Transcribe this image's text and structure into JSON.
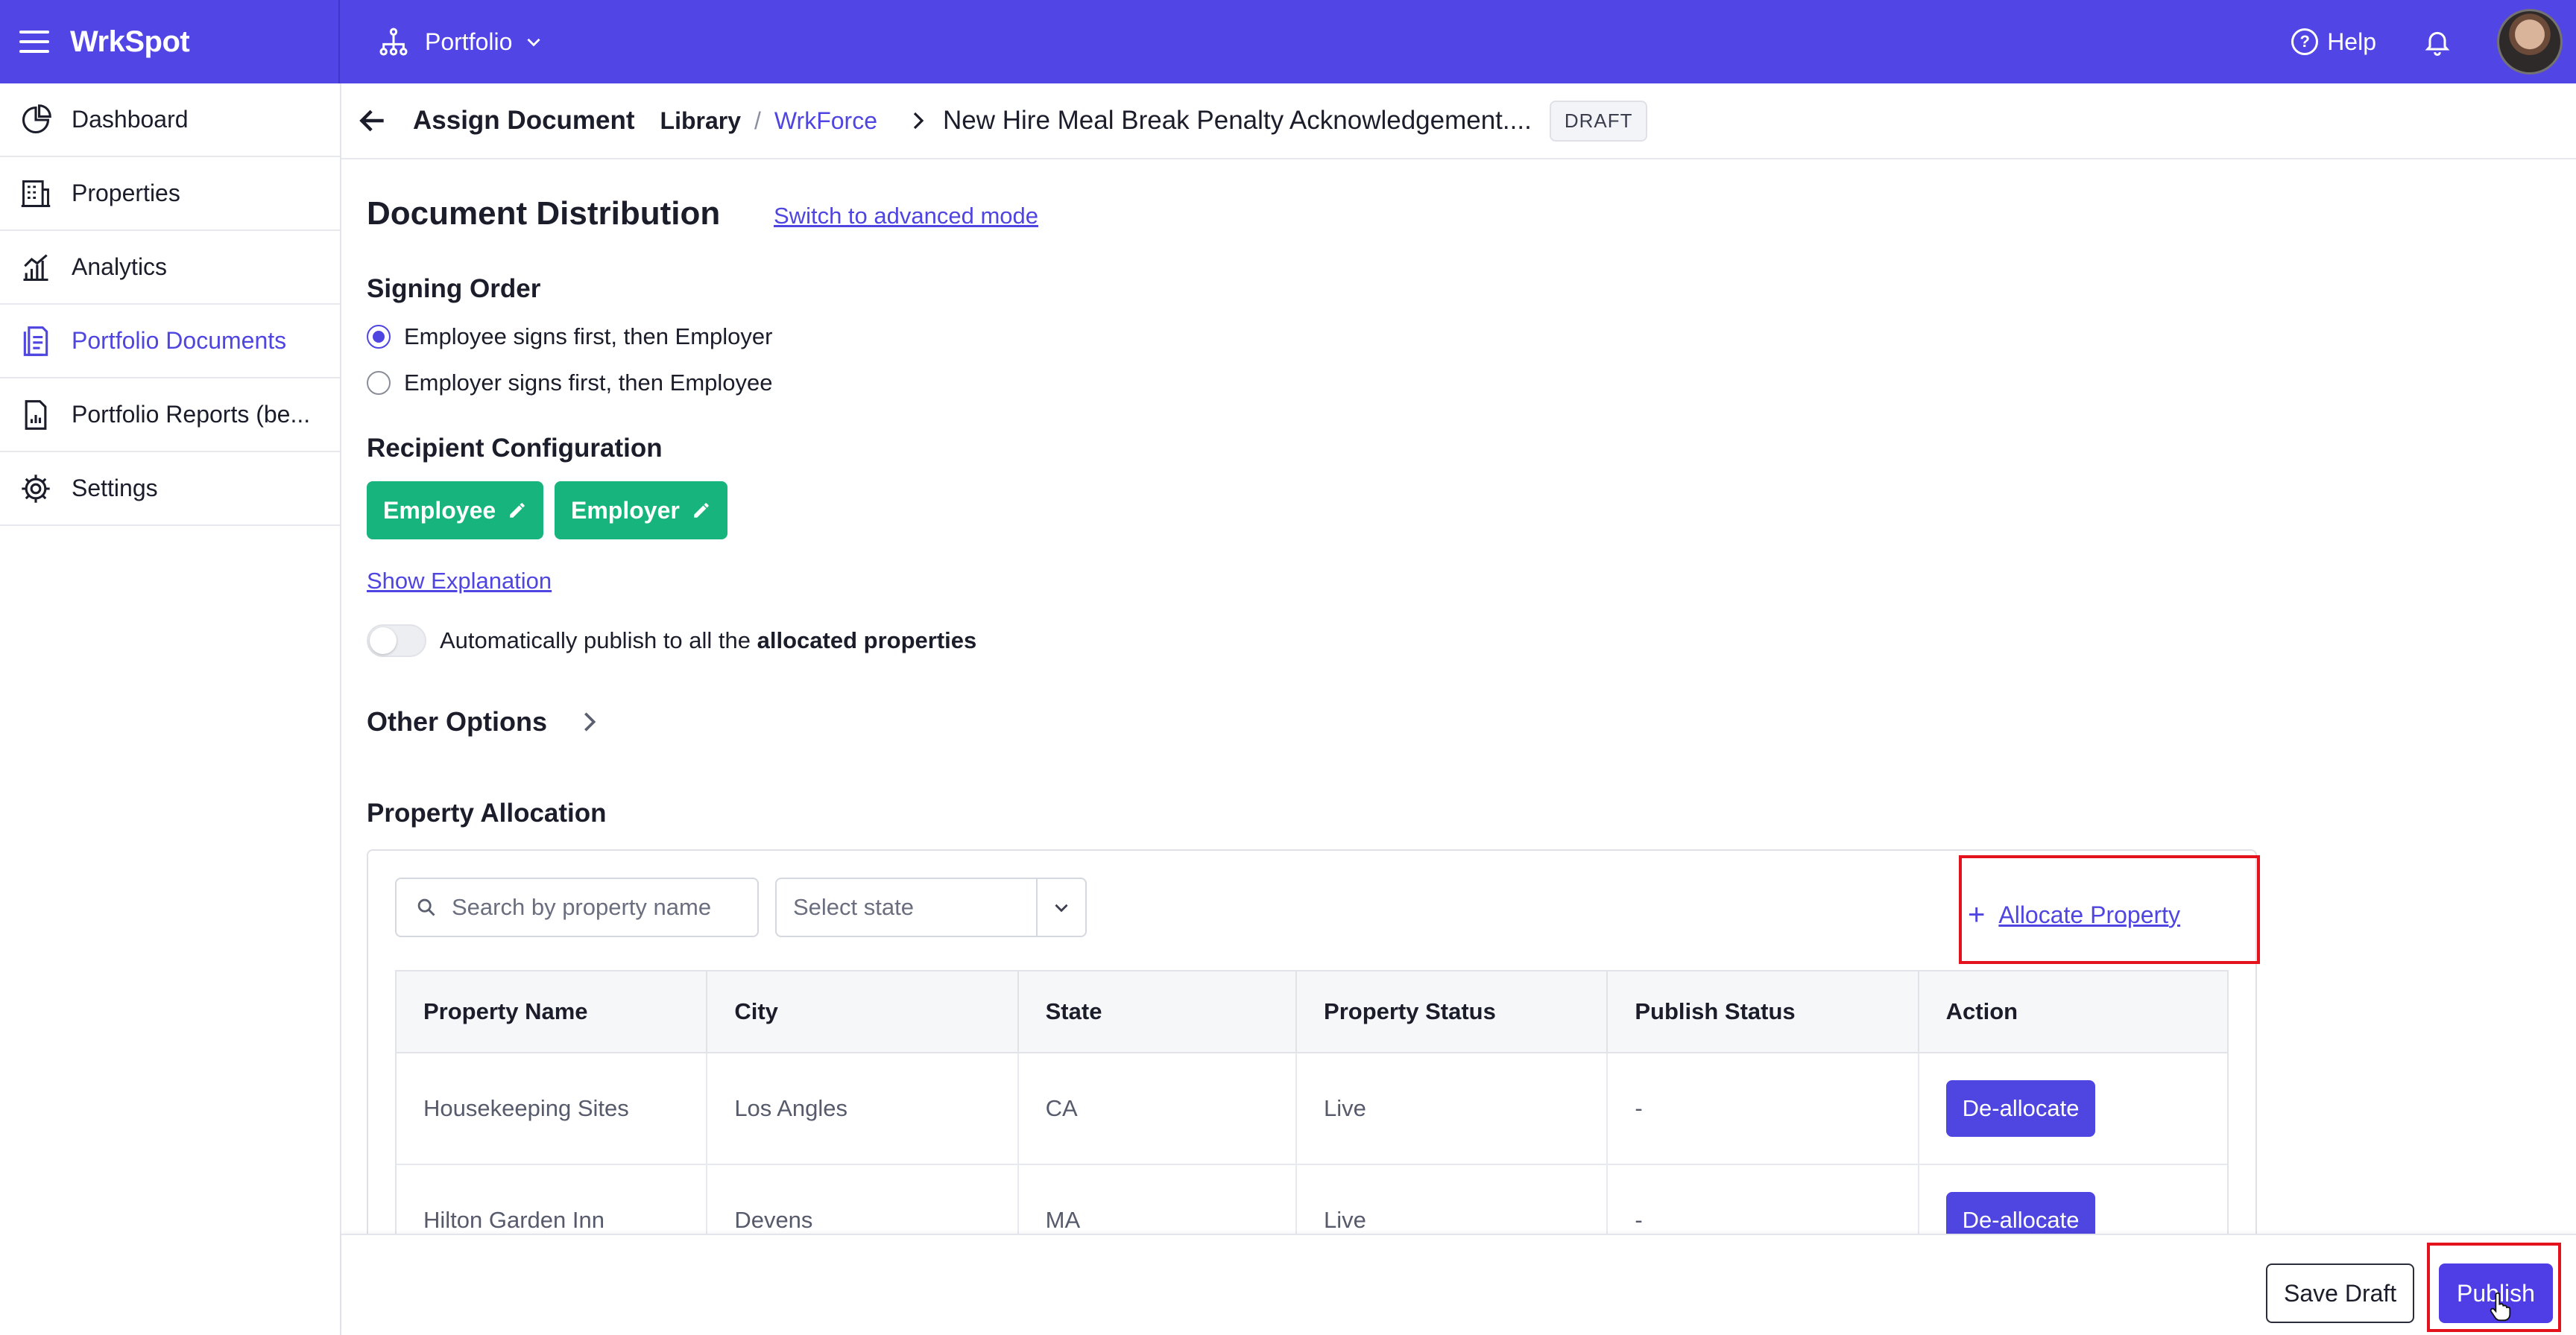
{
  "topbar": {
    "brand": "WrkSpot",
    "portfolio_label": "Portfolio",
    "help_label": "Help"
  },
  "sidebar": {
    "items": [
      {
        "label": "Dashboard",
        "icon": "dashboard-icon",
        "active": false
      },
      {
        "label": "Properties",
        "icon": "building-icon",
        "active": false
      },
      {
        "label": "Analytics",
        "icon": "analytics-icon",
        "active": false
      },
      {
        "label": "Portfolio Documents",
        "icon": "document-icon",
        "active": true
      },
      {
        "label": "Portfolio Reports (be...",
        "icon": "report-icon",
        "active": false
      },
      {
        "label": "Settings",
        "icon": "gear-icon",
        "active": false
      }
    ]
  },
  "header": {
    "title": "Assign Document",
    "breadcrumb": {
      "library": "Library",
      "separator": "/",
      "folder": "WrkForce"
    },
    "document_title": "New Hire Meal Break Penalty Acknowledgement....",
    "status_badge": "DRAFT"
  },
  "distribution": {
    "title": "Document Distribution",
    "advanced_link": "Switch to advanced mode",
    "signing_order": {
      "heading": "Signing Order",
      "options": [
        {
          "label": "Employee signs first, then Employer",
          "selected": true
        },
        {
          "label": "Employer signs first, then Employee",
          "selected": false
        }
      ]
    },
    "recipients": {
      "heading": "Recipient Configuration",
      "chips": [
        "Employee",
        "Employer"
      ]
    },
    "show_explanation": "Show Explanation",
    "auto_publish": {
      "text_prefix": "Automatically publish to all the",
      "text_bold": "allocated properties",
      "enabled": false
    },
    "other_options": "Other Options"
  },
  "allocation": {
    "heading": "Property Allocation",
    "search_placeholder": "Search by property name",
    "state_select": "Select state",
    "allocate_button": "Allocate Property",
    "columns": [
      "Property Name",
      "City",
      "State",
      "Property Status",
      "Publish Status",
      "Action"
    ],
    "rows": [
      {
        "name": "Housekeeping Sites",
        "city": "Los Angles",
        "state": "CA",
        "property_status": "Live",
        "publish_status": "-",
        "action": "De-allocate"
      },
      {
        "name": "Hilton Garden Inn",
        "city": "Devens",
        "state": "MA",
        "property_status": "Live",
        "publish_status": "-",
        "action": "De-allocate"
      }
    ]
  },
  "footer": {
    "save_draft": "Save Draft",
    "publish": "Publish"
  },
  "colors": {
    "brand": "#5146e5",
    "accent": "#4f45e0",
    "chip": "#17b47e",
    "highlight": "#e3121c"
  }
}
